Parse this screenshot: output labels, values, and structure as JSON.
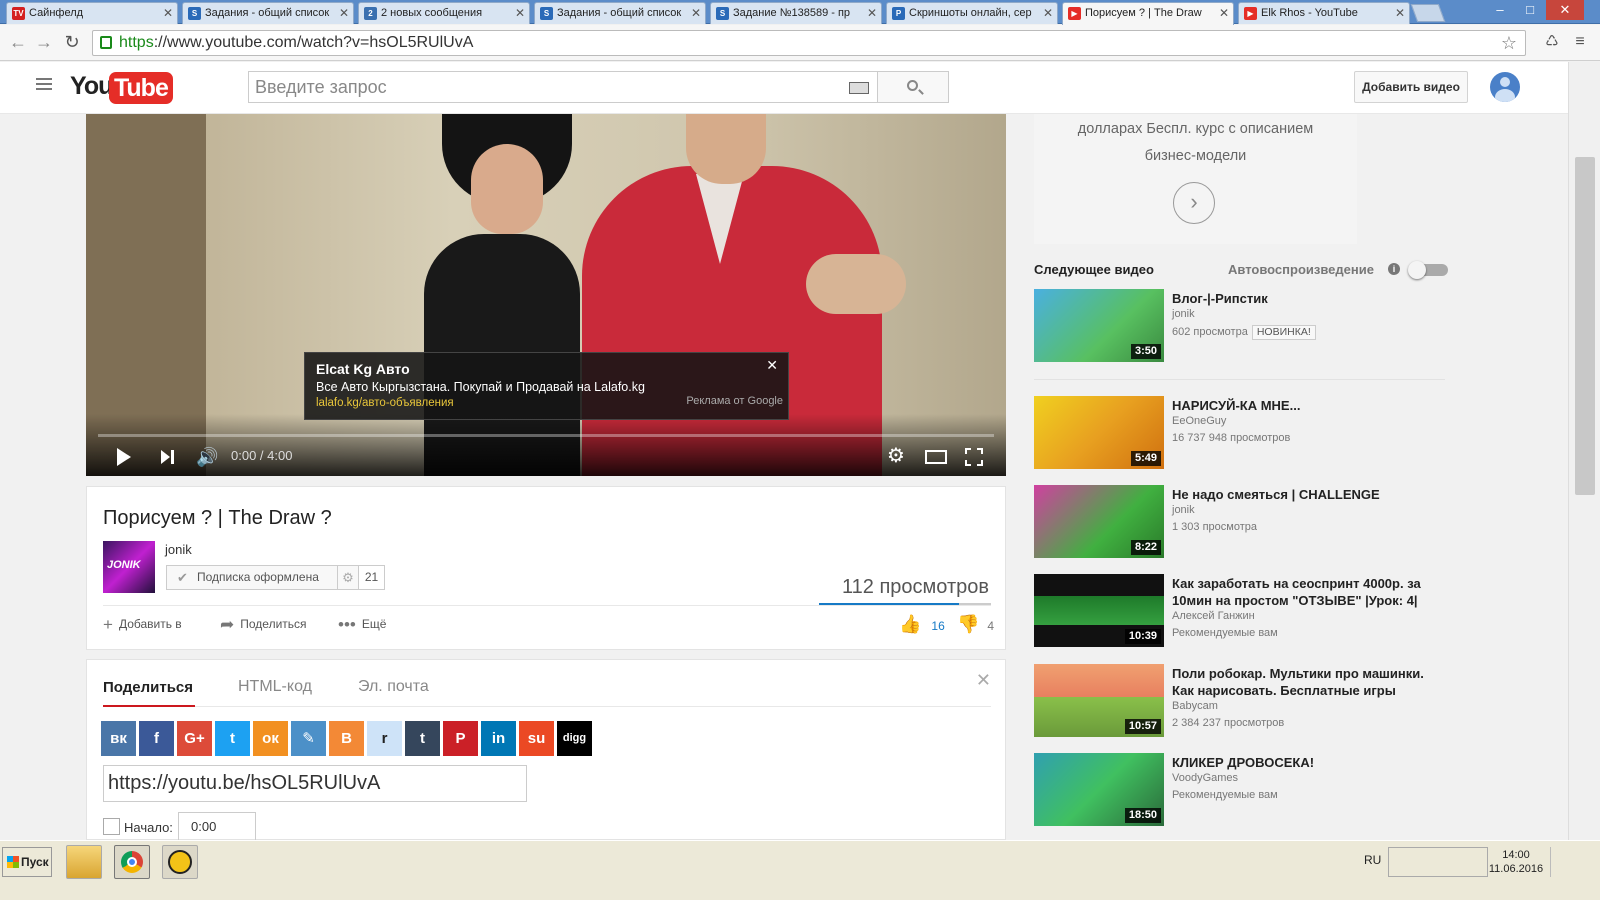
{
  "browser": {
    "tabs": [
      {
        "title": "Сайнфелд",
        "favicon": "tvv"
      },
      {
        "title": "Задания - общий список",
        "favicon": "sp"
      },
      {
        "title": "2 новых сообщения",
        "favicon": "2"
      },
      {
        "title": "Задания - общий список",
        "favicon": "sp"
      },
      {
        "title": "Задание №138589 - пр",
        "favicon": "sp"
      },
      {
        "title": "Скриншоты онлайн, сер",
        "favicon": "p"
      },
      {
        "title": "Порисуем ? | The Draw",
        "favicon": "yt"
      },
      {
        "title": "Elk Rhos - YouTube",
        "favicon": "yt"
      }
    ],
    "url_scheme": "https",
    "url_rest": "://www.youtube.com/watch?v=hsOL5RUlUvA"
  },
  "header": {
    "logo_you": "You",
    "logo_tube": "Tube",
    "search_placeholder": "Введите запрос",
    "upload_label": "Добавить видео"
  },
  "player": {
    "time": "0:00 / 4:00",
    "ad": {
      "title": "Elcat Kg Авто",
      "description": "Все Авто Кыргызстана. Покупай и Продавай на Lalafo.kg",
      "url": "lalafo.kg/авто-объявления",
      "by": "Реклама от Google",
      "close": "✕"
    }
  },
  "video": {
    "title": "Порисуем ? | The Draw ?",
    "channel": "jonik",
    "channel_thumb_text": "JONIK",
    "subscribed_label": "Подписка оформлена",
    "subscriber_count": "21",
    "views": "112 просмотров",
    "actions": {
      "add_to": "Добавить в",
      "share": "Поделиться",
      "more": "Ещё"
    },
    "likes": "16",
    "dislikes": "4"
  },
  "share": {
    "tabs": [
      "Поделиться",
      "HTML-код",
      "Эл. почта"
    ],
    "networks": [
      {
        "name": "vk",
        "glyph": "вк",
        "color": "#4a76a8"
      },
      {
        "name": "facebook",
        "glyph": "f",
        "color": "#3b5998"
      },
      {
        "name": "google-plus",
        "glyph": "G+",
        "color": "#dd4b39"
      },
      {
        "name": "twitter",
        "glyph": "t",
        "color": "#1da1f2"
      },
      {
        "name": "odnoklassniki",
        "glyph": "ок",
        "color": "#f29021"
      },
      {
        "name": "livejournal",
        "glyph": "✎",
        "color": "#4c90c8"
      },
      {
        "name": "blogger",
        "glyph": "B",
        "color": "#f38936"
      },
      {
        "name": "reddit",
        "glyph": "r",
        "color": "#cee3f8"
      },
      {
        "name": "tumblr",
        "glyph": "t",
        "color": "#35465c"
      },
      {
        "name": "pinterest",
        "glyph": "P",
        "color": "#cb2027"
      },
      {
        "name": "linkedin",
        "glyph": "in",
        "color": "#0077b5"
      },
      {
        "name": "stumbleupon",
        "glyph": "su",
        "color": "#eb4924"
      },
      {
        "name": "digg",
        "glyph": "digg",
        "color": "#000000"
      }
    ],
    "url": "https://youtu.be/hsOL5RUlUvA",
    "start_label": "Начало:",
    "start_time": "0:00"
  },
  "sidebar": {
    "ad_text_line1": "долларах Беспл. курс с описанием",
    "ad_text_line2": "бизнес-модели",
    "up_next_label": "Следующее видео",
    "autoplay_label": "Автовоспроизведение",
    "videos": [
      {
        "title": "Влог-|-Рипстик",
        "channel": "jonik",
        "views": "602 просмотра",
        "badge": "НОВИНКА!",
        "duration": "3:50",
        "thumb": "linear-gradient(135deg,#4ab0e0,#58c060 60%,#3a8a40)"
      },
      {
        "title": "НАРИСУЙ-КА МНЕ...",
        "channel": "EeOneGuy",
        "views": "16 737 948 просмотров",
        "badge": "",
        "duration": "5:49",
        "thumb": "linear-gradient(135deg,#f0d020,#e8a020 50%,#d07010)"
      },
      {
        "title": "Не надо смеяться | CHALLENGE",
        "channel": "jonik",
        "views": "1 303 просмотра",
        "badge": "",
        "duration": "8:22",
        "thumb": "linear-gradient(135deg,#d040a0,#40b040 60%,#2a7a2a)"
      },
      {
        "title": "Как заработать на сеоспринт 4000р. за 10мин на простом \"ОТЗЫВЕ\" |Урок: 4|",
        "channel": "Алексей Ганжин",
        "views": "Рекомендуемые вам",
        "badge": "",
        "duration": "10:39",
        "thumb": "linear-gradient(#111,#111 30%,#1e7a2a 30%,#35a040 70%,#111 70%)"
      },
      {
        "title": "Поли робокар. Мультики про машинки. Как нарисовать. Бесплатные игры",
        "channel": "Babycam",
        "views": "2 384 237 просмотров",
        "badge": "",
        "duration": "10:57",
        "thumb": "linear-gradient(#f0a070,#e88060 45%,#8ac04a 45%,#6a9a3a)"
      },
      {
        "title": "КЛИКЕР ДРОВОСЕКА!",
        "channel": "VoodyGames",
        "views": "Рекомендуемые вам",
        "badge": "",
        "duration": "18:50",
        "thumb": "linear-gradient(135deg,#30a0b0,#40c060 50%,#2a6a3a)"
      }
    ]
  },
  "taskbar": {
    "start_label": "Пуск",
    "lang": "RU",
    "time": "14:00",
    "date": "11.06.2016"
  }
}
